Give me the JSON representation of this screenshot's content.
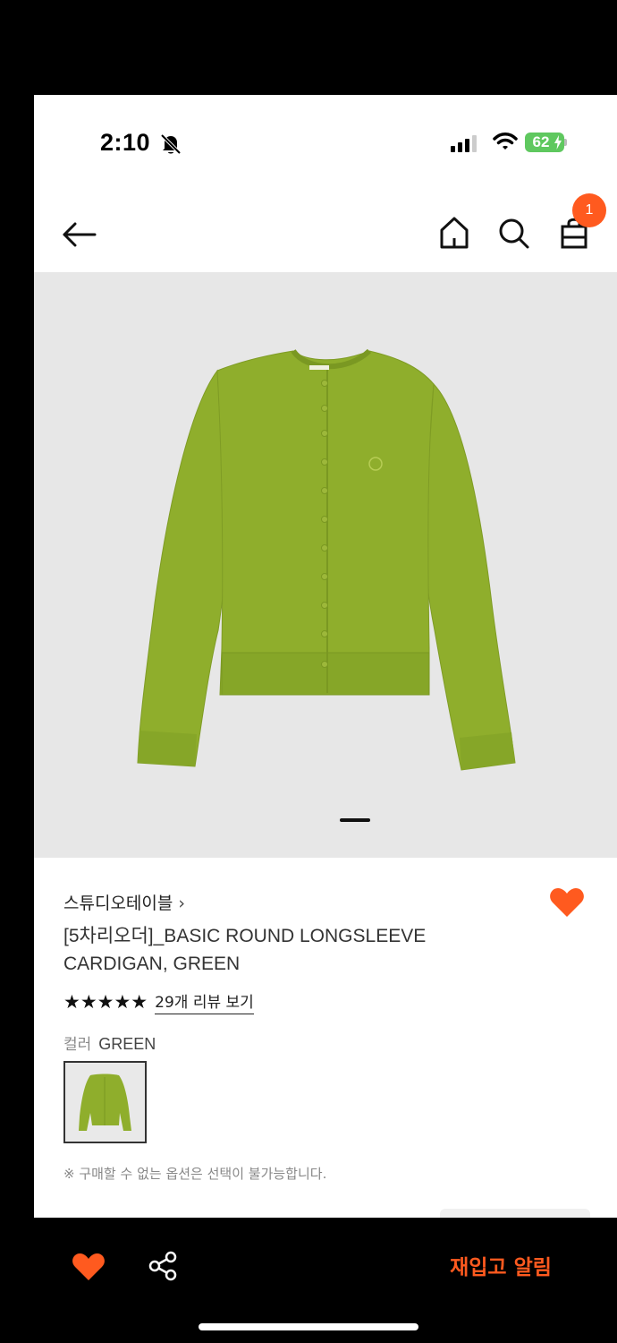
{
  "status_bar": {
    "time": "2:10",
    "battery": "62"
  },
  "header": {
    "cart_count": "1"
  },
  "product": {
    "brand": "스튜디오테이블",
    "brand_chevron": "›",
    "title": "[5차리오더]_BASIC ROUND LONGSLEEVE CARDIGAN, GREEN",
    "rating_stars": "★★★★★",
    "rating_value": 5,
    "review_link": "29개 리뷰 보기",
    "color_label": "컬러",
    "color_value": "GREEN",
    "notice": "※ 구매할 수 없는 옵션은 선택이 불가능합니다.",
    "garment_color": "#8fae2c"
  },
  "bottom_bar": {
    "restock_label": "재입고 알림"
  },
  "colors": {
    "accent": "#ff5a1f",
    "image_bg": "#e7e7e7",
    "garment": "#8fae2c"
  },
  "icons": [
    "bell-slash-icon",
    "signal-icon",
    "wifi-icon",
    "battery-icon",
    "back-arrow-icon",
    "home-icon",
    "search-icon",
    "shopping-bag-icon",
    "heart-icon",
    "share-icon"
  ]
}
